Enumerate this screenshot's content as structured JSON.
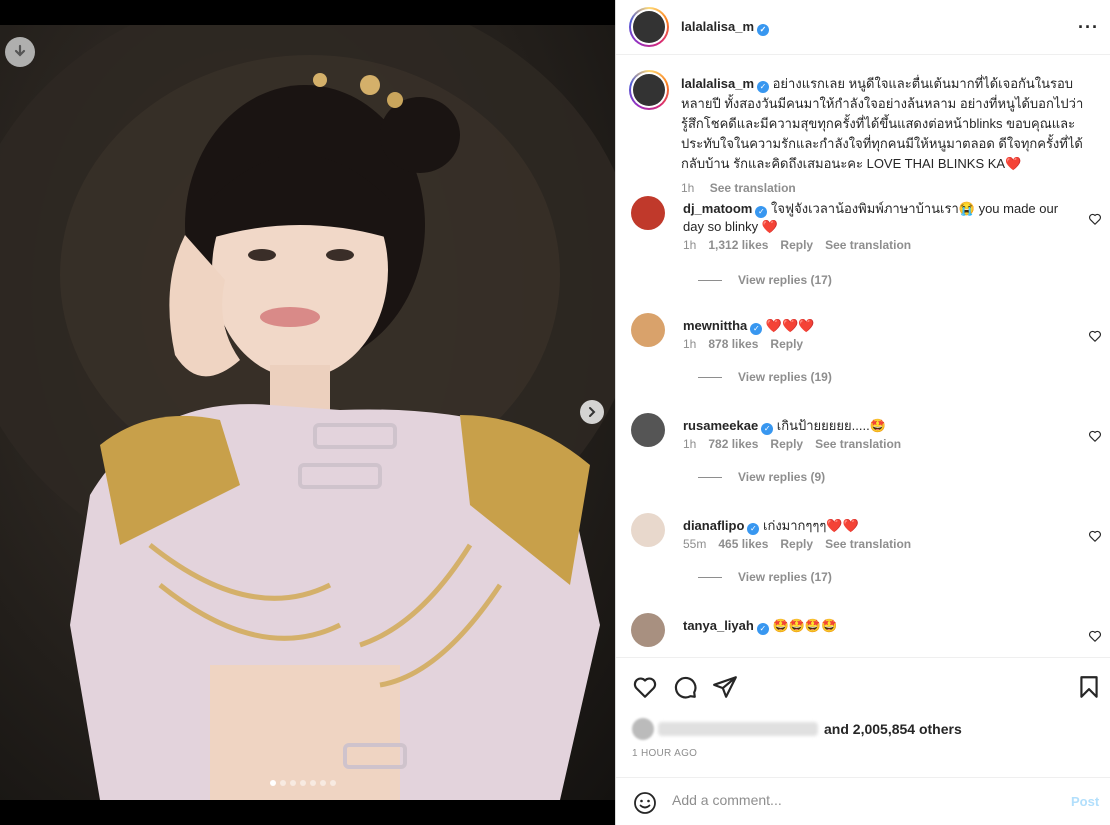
{
  "post": {
    "username": "lalalalisa_m",
    "more_icon": "more-options-icon",
    "carousel_total": 7,
    "carousel_active": 1
  },
  "caption": {
    "username": "lalalalisa_m",
    "text": "อย่างแรกเลย หนูดีใจและตื่นเต้นมากที่ได้เจอกันในรอบหลายปี ทั้งสองวันมีคนมาให้กำลังใจอย่างล้นหลาม อย่างที่หนูได้บอกไปว่า รู้สึกโชคดีและมีความสุขทุกครั้งที่ได้ขึ้นแสดงต่อหน้าblinks ขอบคุณและประทับใจในความรักและกำลังใจที่ทุกคนมีให้หนูมาตลอด ดีใจทุกครั้งที่ได้กลับบ้าน รักและคิดถึงเสมอนะคะ LOVE THAI BLINKS KA❤️",
    "time": "1h",
    "see_translation": "See translation"
  },
  "comments": [
    {
      "username": "dj_matoom",
      "text": "ใจฟูจังเวลาน้องพิมพ์ภาษาบ้านเรา😭 you made our day so blinky ❤️",
      "time": "1h",
      "likes": "1,312 likes",
      "reply": "Reply",
      "see_translation": "See translation",
      "view_replies": "View replies (17)",
      "avatar_color": "#c0392b"
    },
    {
      "username": "mewnittha",
      "text": "❤️❤️❤️",
      "time": "1h",
      "likes": "878 likes",
      "reply": "Reply",
      "see_translation": "",
      "view_replies": "View replies (19)",
      "avatar_color": "#d9a26b"
    },
    {
      "username": "rusameekae",
      "text": "เกินป้ายยยยย.....🤩",
      "time": "1h",
      "likes": "782 likes",
      "reply": "Reply",
      "see_translation": "See translation",
      "view_replies": "View replies (9)",
      "avatar_color": "#555555"
    },
    {
      "username": "dianaflipo",
      "text": "เก่งมากๆๆๆ❤️❤️",
      "time": "55m",
      "likes": "465 likes",
      "reply": "Reply",
      "see_translation": "See translation",
      "view_replies": "View replies (17)",
      "avatar_color": "#e8d8cc"
    },
    {
      "username": "tanya_liyah",
      "text": "🤩🤩🤩🤩",
      "time": "",
      "likes": "",
      "reply": "",
      "see_translation": "",
      "view_replies": "",
      "avatar_color": "#a89080"
    }
  ],
  "actions": {
    "like_icon": "heart-icon",
    "comment_icon": "comment-icon",
    "share_icon": "share-icon",
    "save_icon": "bookmark-icon",
    "likes_text": "and 2,005,854 others",
    "timestamp": "1 HOUR AGO"
  },
  "comment_box": {
    "placeholder": "Add a comment...",
    "post_label": "Post"
  },
  "colors": {
    "verified": "#3897f0",
    "text": "#262626",
    "muted": "#8e8e8e",
    "post_disabled": "#b2dffc"
  }
}
